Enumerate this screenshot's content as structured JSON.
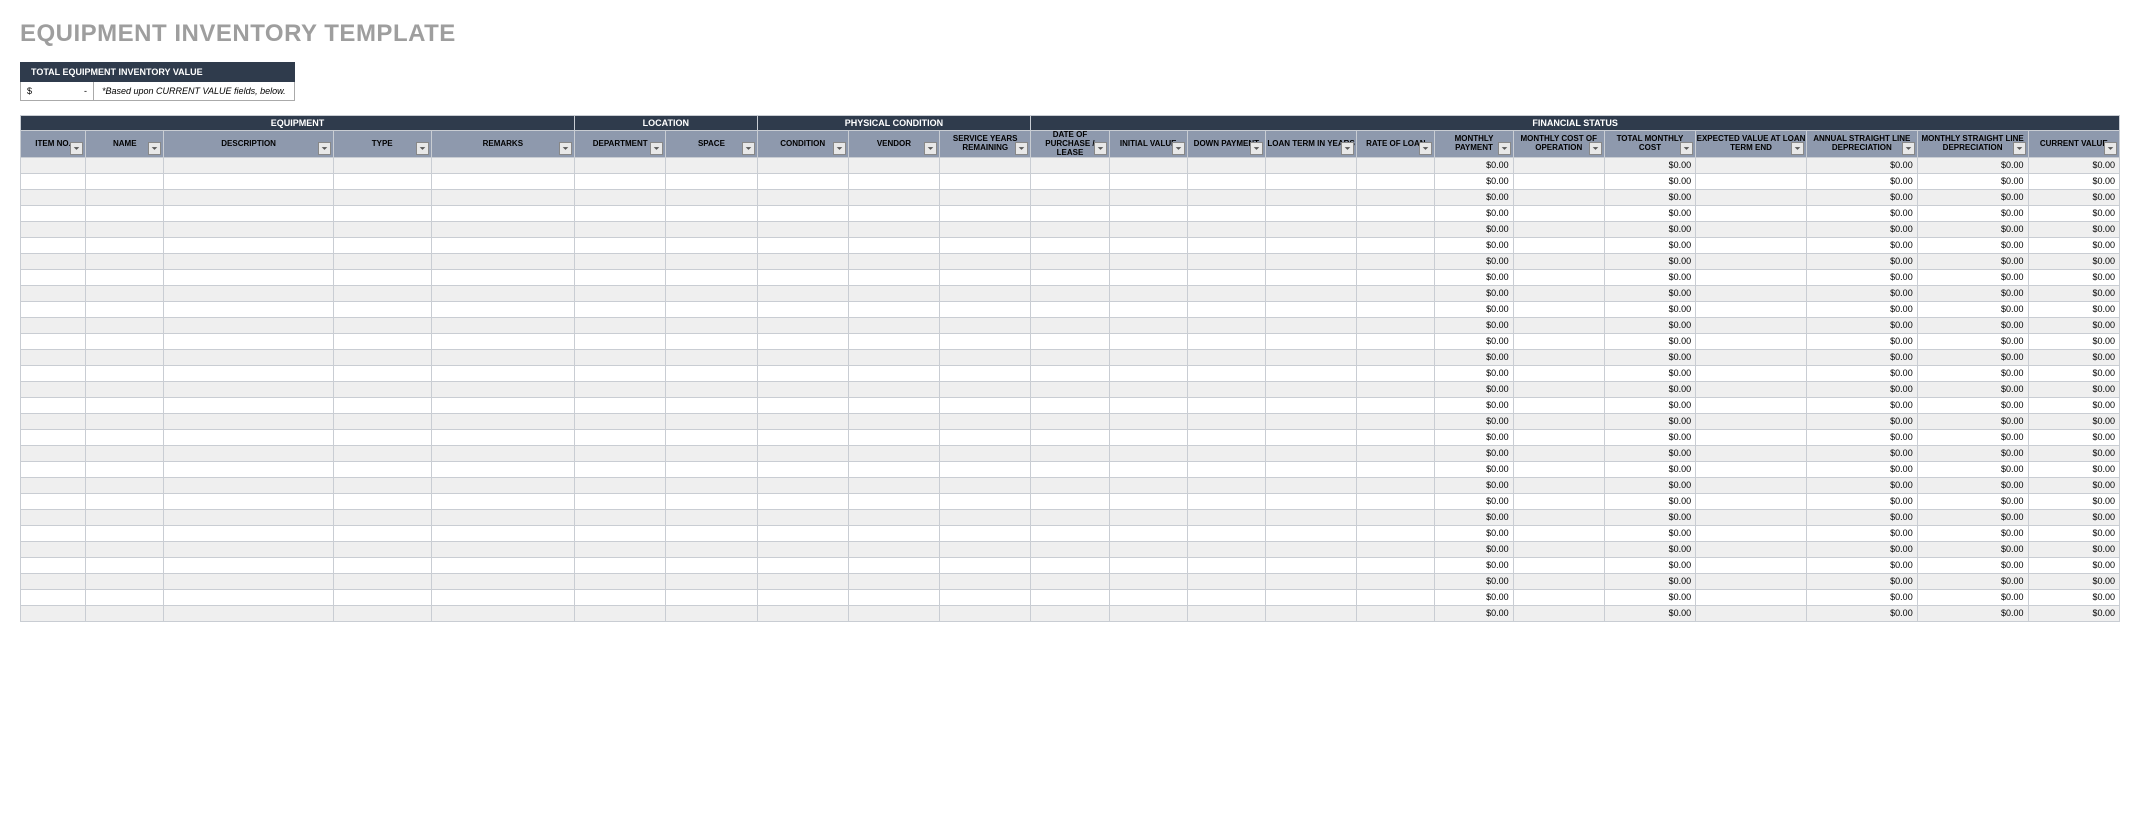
{
  "title": "EQUIPMENT INVENTORY TEMPLATE",
  "summary": {
    "label": "TOTAL EQUIPMENT INVENTORY VALUE",
    "currency": "$",
    "amount": "-",
    "note": "*Based upon CURRENT VALUE fields, below."
  },
  "sections": {
    "equipment": "EQUIPMENT",
    "location": "LOCATION",
    "physical": "PHYSICAL CONDITION",
    "financial": "FINANCIAL STATUS"
  },
  "columns": {
    "item_no": "ITEM NO.",
    "name": "NAME",
    "description": "DESCRIPTION",
    "type": "TYPE",
    "remarks": "REMARKS",
    "department": "DEPARTMENT",
    "space": "SPACE",
    "condition": "CONDITION",
    "vendor": "VENDOR",
    "service_years": "SERVICE YEARS REMAINING",
    "date_purchase": "DATE OF PURCHASE / LEASE",
    "initial_value": "INITIAL VALUE",
    "down_payment": "DOWN PAYMENT",
    "loan_term": "LOAN TERM IN YEARS",
    "rate_loan": "RATE OF LOAN",
    "monthly_payment": "MONTHLY PAYMENT",
    "monthly_cost_op": "MONTHLY COST OF OPERATION",
    "total_monthly": "TOTAL MONTHLY COST",
    "expected_value": "EXPECTED VALUE AT LOAN TERM END",
    "annual_dep": "ANNUAL STRAIGHT LINE DEPRECIATION",
    "monthly_dep": "MONTHLY STRAIGHT LINE DEPRECIATION",
    "current_value": "CURRENT VALUE"
  },
  "row_count": 29,
  "zero_value": "$0.00",
  "zero_columns": [
    "monthly_payment",
    "total_monthly",
    "annual_dep",
    "monthly_dep",
    "current_value"
  ]
}
